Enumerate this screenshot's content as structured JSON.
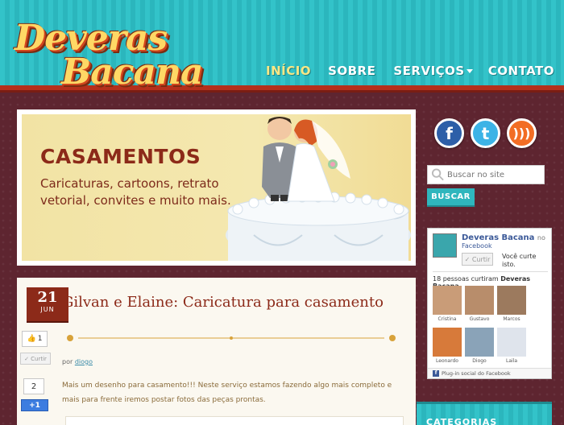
{
  "logo": {
    "line1": "Deveras",
    "line2": "Bacana"
  },
  "nav": {
    "items": [
      {
        "label": "INÍCIO"
      },
      {
        "label": "SOBRE"
      },
      {
        "label": "SERVIÇOS"
      },
      {
        "label": "CONTATO"
      }
    ]
  },
  "banner": {
    "title": "CASAMENTOS",
    "text": "Caricaturas, cartoons, retrato vetorial, convites e muito mais."
  },
  "sidebar": {
    "social": {
      "facebook": "f",
      "twitter": "t",
      "rss": ")))"
    },
    "search": {
      "placeholder": "Buscar no site",
      "button": "BUSCAR"
    },
    "fb_box": {
      "page_name": "Deveras Bacana",
      "on": "no",
      "facebook": "Facebook",
      "like_button": "✓ Curtir",
      "you_like": "Você curte isto.",
      "count_prefix": "18 pessoas curtiram",
      "count_page": "Deveras Bacana.",
      "faces": [
        "Cristina",
        "Gustavo",
        "Marcos",
        "Leonardo",
        "Diogo",
        "Laila"
      ],
      "footer": "Plug-in social do Facebook"
    },
    "categorias": {
      "title": "CATEGORIAS"
    }
  },
  "post": {
    "date": {
      "day": "21",
      "month": "JUN"
    },
    "title": "Gilvan e Elaine: Caricatura para casamento",
    "author_prefix": "por",
    "author": "diogo",
    "body": "Mais um desenho para casamento!!! Neste serviço estamos fazendo algo mais completo e mais para frente iremos postar fotos das peças prontas.",
    "share": {
      "like_count": "1",
      "curtir": "✓ Curtir",
      "gplus_count": "2",
      "gplus": "+1"
    }
  },
  "colors": {
    "teal": "#33c3c9",
    "maroon": "#5e2530",
    "brand_red": "#8c2a19",
    "gold": "#ffd865"
  }
}
